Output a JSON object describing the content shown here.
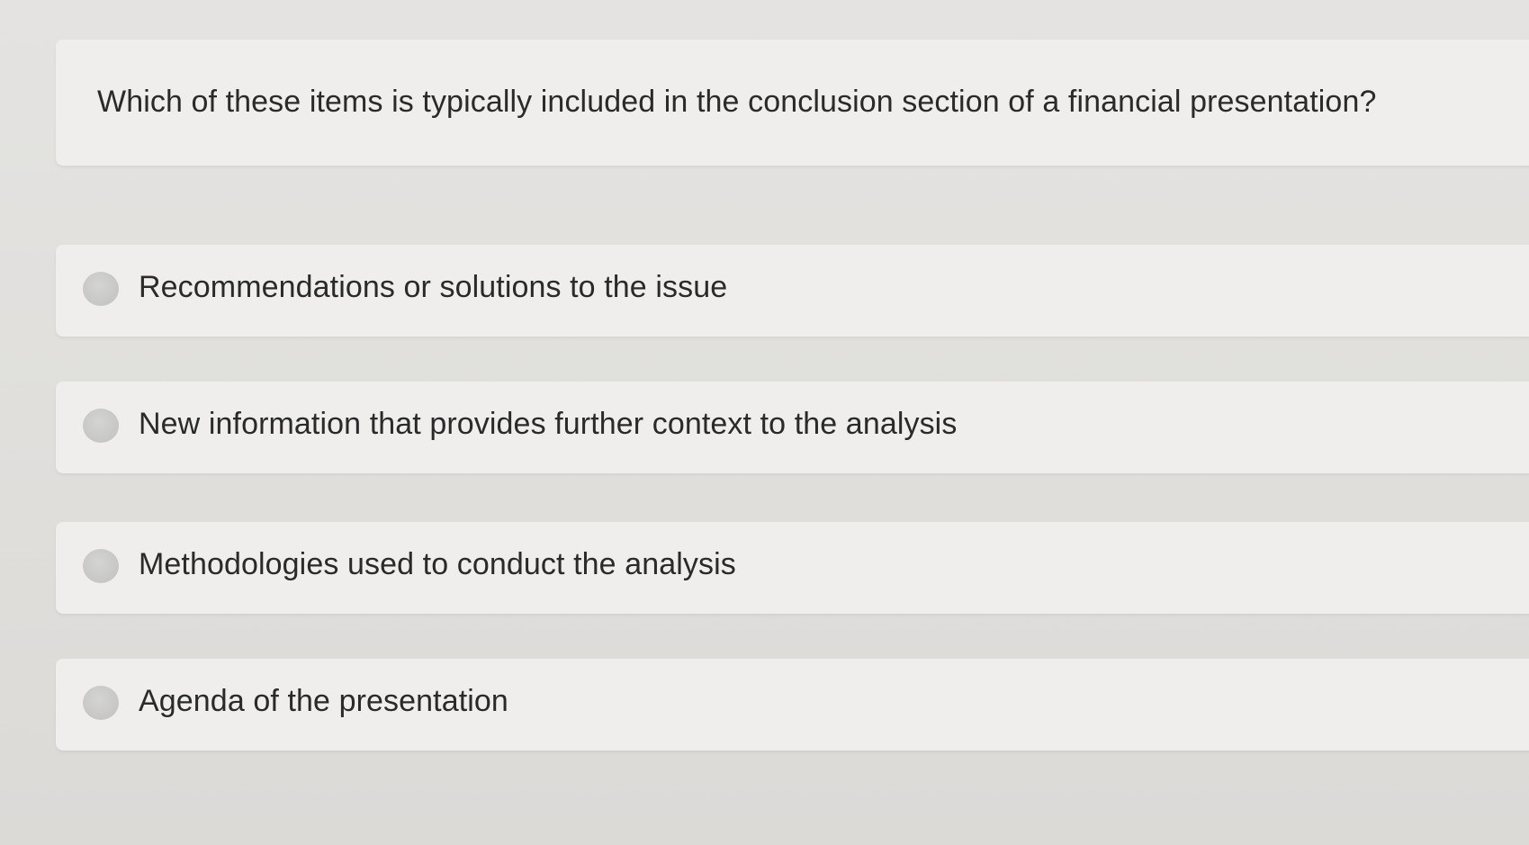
{
  "question": {
    "text": "Which of these items is typically included in the conclusion section of a financial presentation?"
  },
  "options": [
    {
      "label": "Recommendations or solutions to the issue",
      "selected": false
    },
    {
      "label": "New information that provides further context to the analysis",
      "selected": false
    },
    {
      "label": "Methodologies used to conduct the analysis",
      "selected": false
    },
    {
      "label": "Agenda of the presentation",
      "selected": false
    }
  ],
  "colors": {
    "background": "#e2e1df",
    "card": "#efeeec",
    "radio": "#c8c8c6",
    "text": "#2a2a2a"
  }
}
